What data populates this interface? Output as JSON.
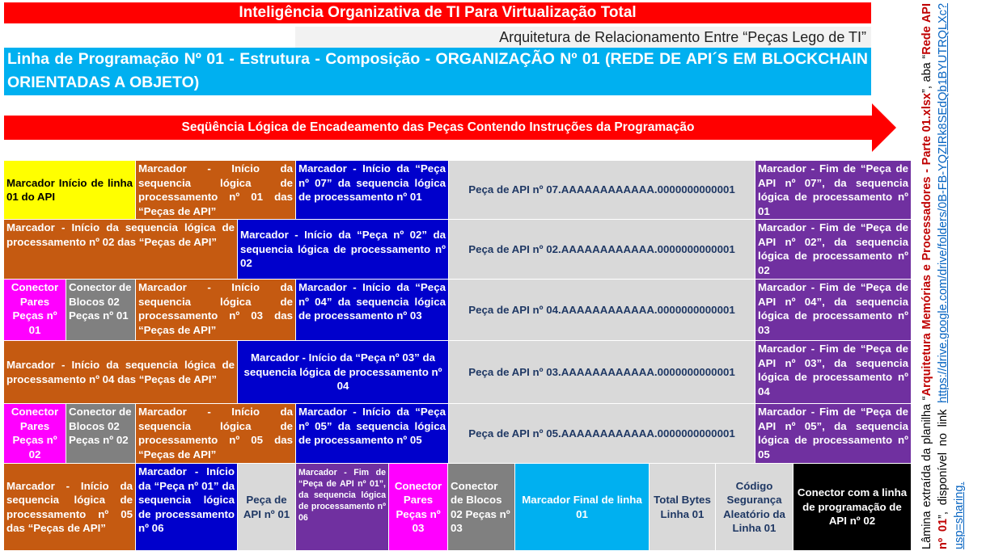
{
  "header": {
    "title": "Inteligência Organizativa de TI Para Virtualização Total",
    "subtitle": "Arquitetura de Relacionamento Entre “Peças Lego de TI”",
    "line_title": "Linha de Programação Nº 01 - Estrutura - Composição - ORGANIZAÇÃO Nº 01 (REDE DE API´S EM BLOCKCHAIN ORIENTADAS A OBJETO)",
    "sequence_label": "Seqüência Lógica de Encadeamento das Peças Contendo Instruções da Programação"
  },
  "rows": {
    "r1": {
      "c1": "Marcador Início de linha 01 do API",
      "c2": "Marcador - Início da sequencia lógica de processamento nº 01 das “Peças de API”",
      "c3": "Marcador - Início da “Peça nº 07” da sequencia lógica de processamento nº 01",
      "c4": "Peça de API nº 07.AAAAAAAAAAAA.0000000000001",
      "c5": "Marcador - Fim de “Peça de API nº 07”, da sequencia lógica de processamento nº 01"
    },
    "r2": {
      "c1": "Marcador - Início da sequencia lógica de processamento nº 02 das “Peças de API”",
      "c2": "Marcador - Início da “Peça nº 02” da sequencia lógica de processamento nº 02",
      "c3": "Peça de API nº 02.AAAAAAAAAAAA.0000000000001",
      "c4": "Marcador - Fim de “Peça de API nº 02”, da sequencia lógica de processamento nº 02"
    },
    "r3": {
      "c1": "Conector Pares Peças nº 01",
      "c2": "Conector de Blocos 02 Peças nº 01",
      "c3": "Marcador - Início da sequencia lógica de processamento nº 03 das “Peças de API”",
      "c4": "Marcador - Início da “Peça nº 04” da sequencia lógica de processamento nº 03",
      "c5": "Peça de API nº 04.AAAAAAAAAAAA.0000000000001",
      "c6": "Marcador - Fim de “Peça de API nº 04”, da sequencia lógica de processamento nº 03"
    },
    "r4": {
      "c1": "Marcador - Início da sequencia lógica de processamento nº 04 das “Peças de API”",
      "c2": "Marcador - Início da “Peça nº 03” da sequencia lógica de processamento nº 04",
      "c3": "Peça de API nº 03.AAAAAAAAAAAA.0000000000001",
      "c4": "Marcador - Fim de “Peça de API nº 03”, da sequencia lógica de processamento nº 04"
    },
    "r5": {
      "c1": "Conector Pares Peças nº 02",
      "c2": "Conector de Blocos 02 Peças nº 02",
      "c3": "Marcador - Início da sequencia lógica de processamento nº 05 das “Peças de API”",
      "c4": "Marcador - Início da “Peça nº 05” da sequencia lógica de processamento nº 05",
      "c5": "Peça de API nº 05.AAAAAAAAAAAA.0000000000001",
      "c6": "Marcador - Fim de “Peça de API nº 05”, da sequencia lógica de processamento nº 05"
    },
    "r6": {
      "c1": "Marcador - Início da sequencia lógica de processamento nº 05 das “Peças de API”",
      "c2": "Marcador - Início da “Peça nº 01” da sequencia lógica de processamento nº 06",
      "c3": "Peça de API nº 01",
      "c4": "Marcador - Fim de “Peça de API nº 01”, da sequencia lógica de processamento nº 06",
      "c5": "Conector Pares Peças nº 03",
      "c6": "Conector de Blocos 02 Peças nº 03",
      "c7": "Marcador Final de linha 01",
      "c8": "Total Bytes Linha 01",
      "c9": "Código Segurança Aleatório da Linha 01",
      "c10": "Conector com a linha de programação de API nº 02"
    }
  },
  "side_note": {
    "t1": "Lâmina extraída da planilha “",
    "t2": "Arquitetura Memórias e Processadores - Parte 01.xlsx",
    "t3": "”, aba “",
    "t4": "Rede API nº 01",
    "t5": "”, disponível no link ",
    "link": "https://drive.google.com/drive/folders/0B-FB-YQZIRk8SEdQb1BYUTRQLXc?usp=sharing."
  },
  "colors": {
    "red": "#ff0000",
    "cyan": "#00b0f0",
    "yellow": "#ffff00",
    "orange": "#c55a11",
    "blue": "#0000cc",
    "grey": "#d9d9d9",
    "purple": "#7030a0",
    "magenta": "#ff00ff",
    "dark_grey": "#808080",
    "black": "#000000",
    "dark_red": "#c00000"
  }
}
